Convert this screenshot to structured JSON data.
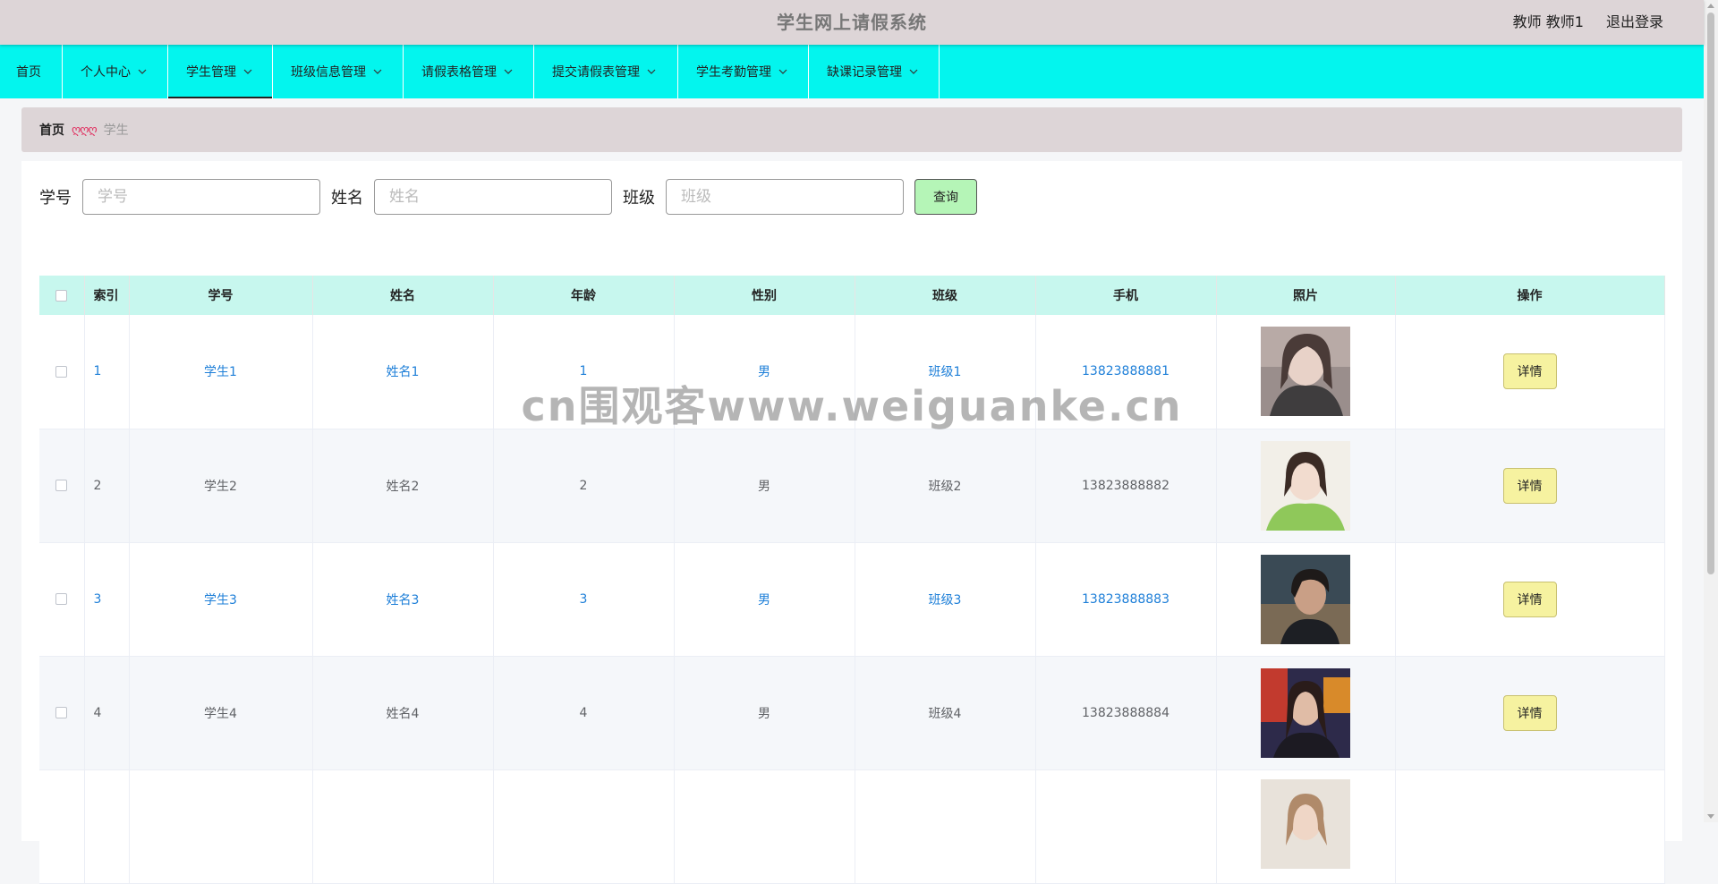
{
  "header": {
    "title": "学生网上请假系统",
    "user": "教师 教师1",
    "logout": "退出登录"
  },
  "nav": {
    "items": [
      {
        "label": "首页",
        "has_dropdown": false,
        "active": false
      },
      {
        "label": "个人中心",
        "has_dropdown": true,
        "active": false
      },
      {
        "label": "学生管理",
        "has_dropdown": true,
        "active": true
      },
      {
        "label": "班级信息管理",
        "has_dropdown": true,
        "active": false
      },
      {
        "label": "请假表格管理",
        "has_dropdown": true,
        "active": false
      },
      {
        "label": "提交请假表管理",
        "has_dropdown": true,
        "active": false
      },
      {
        "label": "学生考勤管理",
        "has_dropdown": true,
        "active": false
      },
      {
        "label": "缺课记录管理",
        "has_dropdown": true,
        "active": false
      }
    ]
  },
  "breadcrumb": {
    "home": "首页",
    "separator": "ღღღ",
    "current": "学生"
  },
  "search": {
    "student_no_label": "学号",
    "student_no_placeholder": "学号",
    "student_no_value": "",
    "name_label": "姓名",
    "name_placeholder": "姓名",
    "name_value": "",
    "class_label": "班级",
    "class_placeholder": "班级",
    "class_value": "",
    "query_button": "查询"
  },
  "table": {
    "columns": [
      "索引",
      "学号",
      "姓名",
      "年龄",
      "性别",
      "班级",
      "手机",
      "照片",
      "操作"
    ],
    "detail_label": "详情",
    "rows": [
      {
        "index": "1",
        "student_no": "学生1",
        "name": "姓名1",
        "age": "1",
        "gender": "男",
        "class": "班级1",
        "phone": "13823888881"
      },
      {
        "index": "2",
        "student_no": "学生2",
        "name": "姓名2",
        "age": "2",
        "gender": "男",
        "class": "班级2",
        "phone": "13823888882"
      },
      {
        "index": "3",
        "student_no": "学生3",
        "name": "姓名3",
        "age": "3",
        "gender": "男",
        "class": "班级3",
        "phone": "13823888883"
      },
      {
        "index": "4",
        "student_no": "学生4",
        "name": "姓名4",
        "age": "4",
        "gender": "男",
        "class": "班级4",
        "phone": "13823888884"
      }
    ]
  },
  "watermark": "cn围观客www.weiguanke.cn",
  "colors": {
    "header_bg": "#ddd5d7",
    "nav_bg": "#03f5ee",
    "table_header_bg": "#c7f7ee",
    "link_blue": "#1e7fd8",
    "query_button_bg": "#b5f5b7",
    "detail_button_bg": "#f6f2a0"
  }
}
